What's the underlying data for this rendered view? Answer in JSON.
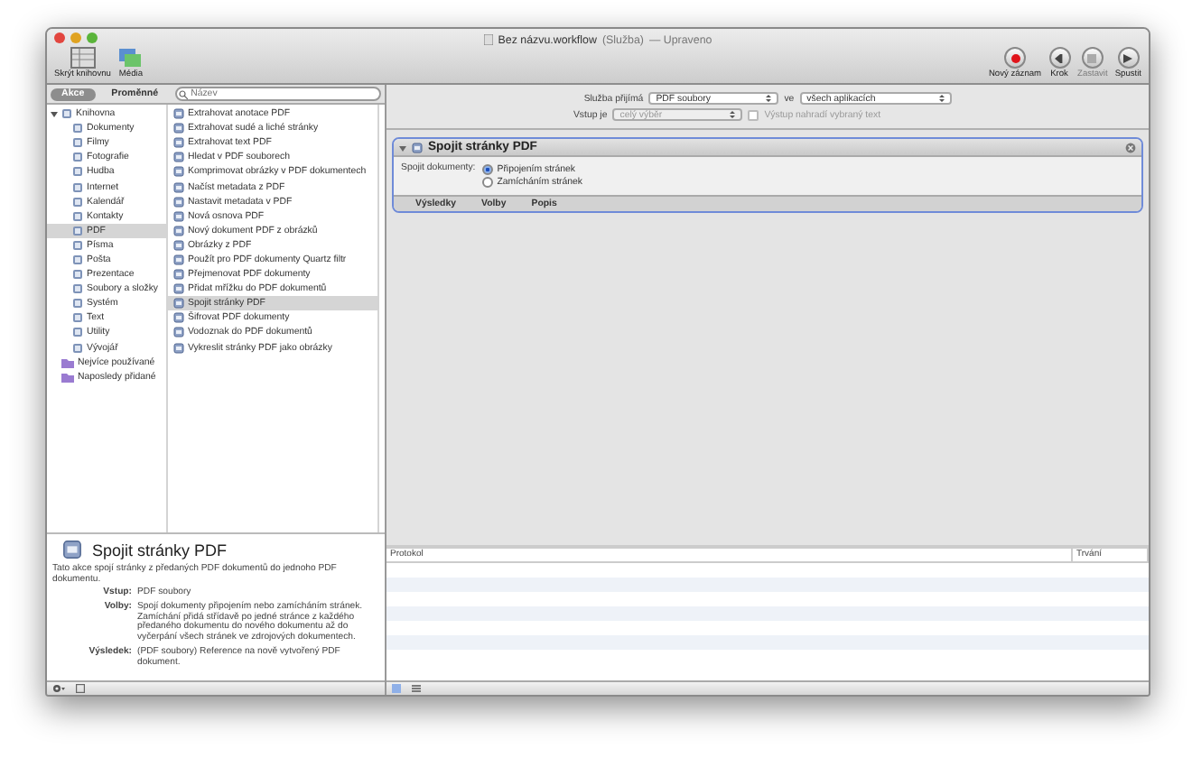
{
  "window": {
    "title": "Bez názvu.workflow",
    "subtitle": "(Služba)",
    "status": "— Upraveno"
  },
  "toolbar_left": [
    {
      "label": "Skrýt knihovnu",
      "kind": "library"
    },
    {
      "label": "Média",
      "kind": "media"
    }
  ],
  "toolbar_right": [
    {
      "label": "Nový záznam",
      "kind": "record",
      "disabled": false
    },
    {
      "label": "Krok",
      "kind": "step",
      "disabled": false
    },
    {
      "label": "Zastavit",
      "kind": "stop",
      "disabled": true
    },
    {
      "label": "Spustit",
      "kind": "run",
      "disabled": false
    }
  ],
  "tabs": [
    {
      "label": "Akce",
      "selected": true
    },
    {
      "label": "Proměnné",
      "selected": false
    }
  ],
  "search": {
    "placeholder": "Název"
  },
  "library": [
    {
      "label": "Knihovna",
      "kind": "library",
      "expanded": true,
      "selected": false,
      "children": [
        {
          "label": "Dokumenty",
          "selected": false
        },
        {
          "label": "Filmy",
          "selected": false
        },
        {
          "label": "Fotografie",
          "selected": false
        },
        {
          "label": "Hudba",
          "selected": false
        },
        {
          "label": "Internet",
          "selected": false
        },
        {
          "label": "Kalendář",
          "selected": false
        },
        {
          "label": "Kontakty",
          "selected": false
        },
        {
          "label": "PDF",
          "selected": true
        },
        {
          "label": "Písma",
          "selected": false
        },
        {
          "label": "Pošta",
          "selected": false
        },
        {
          "label": "Prezentace",
          "selected": false
        },
        {
          "label": "Soubory a složky",
          "selected": false
        },
        {
          "label": "Systém",
          "selected": false
        },
        {
          "label": "Text",
          "selected": false
        },
        {
          "label": "Utility",
          "selected": false
        },
        {
          "label": "Vývojář",
          "selected": false
        }
      ]
    },
    {
      "label": "Nejvíce používané",
      "kind": "folder",
      "expanded": false,
      "selected": false
    },
    {
      "label": "Naposledy přidané",
      "kind": "folder",
      "expanded": false,
      "selected": false
    }
  ],
  "actions": [
    {
      "label": "Extrahovat anotace PDF",
      "selected": false
    },
    {
      "label": "Extrahovat sudé a liché stránky",
      "selected": false
    },
    {
      "label": "Extrahovat text PDF",
      "selected": false
    },
    {
      "label": "Hledat v PDF souborech",
      "selected": false
    },
    {
      "label": "Komprimovat obrázky v PDF dokumentech",
      "selected": false
    },
    {
      "label": "Načíst metadata z PDF",
      "selected": false
    },
    {
      "label": "Nastavit metadata v PDF",
      "selected": false
    },
    {
      "label": "Nová osnova PDF",
      "selected": false
    },
    {
      "label": "Nový dokument PDF z obrázků",
      "selected": false
    },
    {
      "label": "Obrázky z PDF",
      "selected": false
    },
    {
      "label": "Použít pro PDF dokumenty Quartz filtr",
      "selected": false
    },
    {
      "label": "Přejmenovat PDF dokumenty",
      "selected": false
    },
    {
      "label": "Přidat mřížku do PDF dokumentů",
      "selected": false
    },
    {
      "label": "Spojit stránky PDF",
      "selected": true
    },
    {
      "label": "Šifrovat PDF dokumenty",
      "selected": false
    },
    {
      "label": "Vodoznak do PDF dokumentů",
      "selected": false
    },
    {
      "label": "Vykreslit stránky PDF jako obrázky",
      "selected": false
    }
  ],
  "service": {
    "receives_label": "Služba přijímá",
    "receives_value": "PDF soubory",
    "in_label": "ve",
    "in_value": "všech aplikacích",
    "input_label": "Vstup je",
    "input_value": "celý výběr",
    "input_disabled": true,
    "replace_label": "Výstup nahradí vybraný text",
    "replace_checked": false,
    "replace_disabled": true
  },
  "action_card": {
    "title": "Spojit stránky PDF",
    "expanded": true,
    "field_label": "Spojit dokumenty:",
    "options": [
      {
        "label": "Připojením stránek",
        "selected": true
      },
      {
        "label": "Zamícháním stránek",
        "selected": false
      }
    ],
    "footer_tabs": [
      "Výsledky",
      "Volby",
      "Popis"
    ]
  },
  "description": {
    "title": "Spojit stránky PDF",
    "text": "Tato akce spojí stránky z předaných PDF dokumentů do jednoho PDF dokumentu.",
    "rows": [
      {
        "label": "Vstup:",
        "value": "PDF soubory"
      },
      {
        "label": "Volby:",
        "value": "Spojí dokumenty připojením nebo zamícháním stránek. Zamíchání přidá střídavě po jedné stránce z každého předaného dokumentu do nového dokumentu až do vyčerpání všech stránek ve zdrojových dokumentech."
      },
      {
        "label": "Výsledek:",
        "value": "(PDF soubory) Reference na nově vytvořený PDF dokument."
      }
    ]
  },
  "log": {
    "columns": [
      "Protokol",
      "Trvání"
    ]
  }
}
